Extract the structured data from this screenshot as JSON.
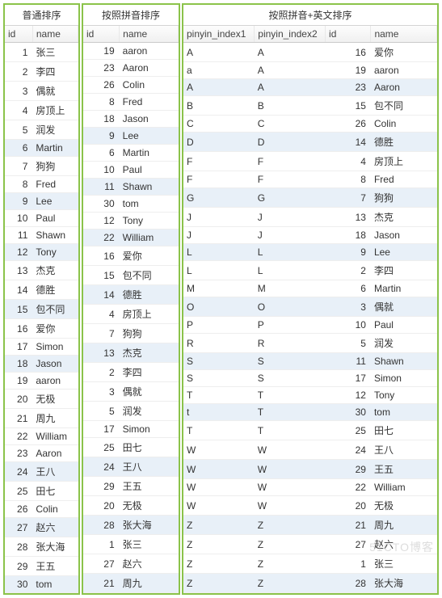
{
  "watermark": "51CTO博客",
  "panels": [
    {
      "title": "普通排序",
      "columns": [
        {
          "key": "id",
          "label": "id",
          "align": "num",
          "width": "38%"
        },
        {
          "key": "name",
          "label": "name",
          "align": "",
          "width": "62%"
        }
      ],
      "highlight": [
        5,
        8,
        11,
        14,
        17,
        23,
        26,
        29
      ],
      "rows": [
        {
          "id": 1,
          "name": "张三"
        },
        {
          "id": 2,
          "name": "李四"
        },
        {
          "id": 3,
          "name": "偶就"
        },
        {
          "id": 4,
          "name": "房顶上"
        },
        {
          "id": 5,
          "name": "润发"
        },
        {
          "id": 6,
          "name": "Martin"
        },
        {
          "id": 7,
          "name": "狗狗"
        },
        {
          "id": 8,
          "name": "Fred"
        },
        {
          "id": 9,
          "name": "Lee"
        },
        {
          "id": 10,
          "name": "Paul"
        },
        {
          "id": 11,
          "name": "Shawn"
        },
        {
          "id": 12,
          "name": "Tony"
        },
        {
          "id": 13,
          "name": "杰克"
        },
        {
          "id": 14,
          "name": "德胜"
        },
        {
          "id": 15,
          "name": "包不同"
        },
        {
          "id": 16,
          "name": "爱你"
        },
        {
          "id": 17,
          "name": "Simon"
        },
        {
          "id": 18,
          "name": "Jason"
        },
        {
          "id": 19,
          "name": "aaron"
        },
        {
          "id": 20,
          "name": "无极"
        },
        {
          "id": 21,
          "name": "周九"
        },
        {
          "id": 22,
          "name": "William"
        },
        {
          "id": 23,
          "name": "Aaron"
        },
        {
          "id": 24,
          "name": "王八"
        },
        {
          "id": 25,
          "name": "田七"
        },
        {
          "id": 26,
          "name": "Colin"
        },
        {
          "id": 27,
          "name": "赵六"
        },
        {
          "id": 28,
          "name": "张大海"
        },
        {
          "id": 29,
          "name": "王五"
        },
        {
          "id": 30,
          "name": "tom"
        }
      ]
    },
    {
      "title": "按照拼音排序",
      "columns": [
        {
          "key": "id",
          "label": "id",
          "align": "num",
          "width": "38%"
        },
        {
          "key": "name",
          "label": "name",
          "align": "",
          "width": "62%"
        }
      ],
      "highlight": [
        5,
        8,
        11,
        14,
        17,
        23,
        26,
        29
      ],
      "rows": [
        {
          "id": 19,
          "name": "aaron"
        },
        {
          "id": 23,
          "name": "Aaron"
        },
        {
          "id": 26,
          "name": "Colin"
        },
        {
          "id": 8,
          "name": "Fred"
        },
        {
          "id": 18,
          "name": "Jason"
        },
        {
          "id": 9,
          "name": "Lee"
        },
        {
          "id": 6,
          "name": "Martin"
        },
        {
          "id": 10,
          "name": "Paul"
        },
        {
          "id": 11,
          "name": "Shawn"
        },
        {
          "id": 30,
          "name": "tom"
        },
        {
          "id": 12,
          "name": "Tony"
        },
        {
          "id": 22,
          "name": "William"
        },
        {
          "id": 16,
          "name": "爱你"
        },
        {
          "id": 15,
          "name": "包不同"
        },
        {
          "id": 14,
          "name": "德胜"
        },
        {
          "id": 4,
          "name": "房顶上"
        },
        {
          "id": 7,
          "name": "狗狗"
        },
        {
          "id": 13,
          "name": "杰克"
        },
        {
          "id": 2,
          "name": "李四"
        },
        {
          "id": 3,
          "name": "偶就"
        },
        {
          "id": 5,
          "name": "润发"
        },
        {
          "id": 17,
          "name": "Simon"
        },
        {
          "id": 25,
          "name": "田七"
        },
        {
          "id": 24,
          "name": "王八"
        },
        {
          "id": 29,
          "name": "王五"
        },
        {
          "id": 20,
          "name": "无极"
        },
        {
          "id": 28,
          "name": "张大海"
        },
        {
          "id": 1,
          "name": "张三"
        },
        {
          "id": 27,
          "name": "赵六"
        },
        {
          "id": 21,
          "name": "周九"
        }
      ]
    },
    {
      "title": "按照拼音+英文排序",
      "columns": [
        {
          "key": "p1",
          "label": "pinyin_index1",
          "align": "",
          "width": "28%"
        },
        {
          "key": "p2",
          "label": "pinyin_index2",
          "align": "",
          "width": "28%"
        },
        {
          "key": "id",
          "label": "id",
          "align": "num",
          "width": "18%"
        },
        {
          "key": "name",
          "label": "name",
          "align": "",
          "width": "26%"
        }
      ],
      "highlight": [
        2,
        5,
        8,
        11,
        14,
        17,
        20,
        23,
        26,
        29
      ],
      "rows": [
        {
          "p1": "A",
          "p2": "A",
          "id": 16,
          "name": "爱你"
        },
        {
          "p1": "a",
          "p2": "A",
          "id": 19,
          "name": "aaron"
        },
        {
          "p1": "A",
          "p2": "A",
          "id": 23,
          "name": "Aaron"
        },
        {
          "p1": "B",
          "p2": "B",
          "id": 15,
          "name": "包不同"
        },
        {
          "p1": "C",
          "p2": "C",
          "id": 26,
          "name": "Colin"
        },
        {
          "p1": "D",
          "p2": "D",
          "id": 14,
          "name": "德胜"
        },
        {
          "p1": "F",
          "p2": "F",
          "id": 4,
          "name": "房顶上"
        },
        {
          "p1": "F",
          "p2": "F",
          "id": 8,
          "name": "Fred"
        },
        {
          "p1": "G",
          "p2": "G",
          "id": 7,
          "name": "狗狗"
        },
        {
          "p1": "J",
          "p2": "J",
          "id": 13,
          "name": "杰克"
        },
        {
          "p1": "J",
          "p2": "J",
          "id": 18,
          "name": "Jason"
        },
        {
          "p1": "L",
          "p2": "L",
          "id": 9,
          "name": "Lee"
        },
        {
          "p1": "L",
          "p2": "L",
          "id": 2,
          "name": "李四"
        },
        {
          "p1": "M",
          "p2": "M",
          "id": 6,
          "name": "Martin"
        },
        {
          "p1": "O",
          "p2": "O",
          "id": 3,
          "name": "偶就"
        },
        {
          "p1": "P",
          "p2": "P",
          "id": 10,
          "name": "Paul"
        },
        {
          "p1": "R",
          "p2": "R",
          "id": 5,
          "name": "润发"
        },
        {
          "p1": "S",
          "p2": "S",
          "id": 11,
          "name": "Shawn"
        },
        {
          "p1": "S",
          "p2": "S",
          "id": 17,
          "name": "Simon"
        },
        {
          "p1": "T",
          "p2": "T",
          "id": 12,
          "name": "Tony"
        },
        {
          "p1": "t",
          "p2": "T",
          "id": 30,
          "name": "tom"
        },
        {
          "p1": "T",
          "p2": "T",
          "id": 25,
          "name": "田七"
        },
        {
          "p1": "W",
          "p2": "W",
          "id": 24,
          "name": "王八"
        },
        {
          "p1": "W",
          "p2": "W",
          "id": 29,
          "name": "王五"
        },
        {
          "p1": "W",
          "p2": "W",
          "id": 22,
          "name": "William"
        },
        {
          "p1": "W",
          "p2": "W",
          "id": 20,
          "name": "无极"
        },
        {
          "p1": "Z",
          "p2": "Z",
          "id": 21,
          "name": "周九"
        },
        {
          "p1": "Z",
          "p2": "Z",
          "id": 27,
          "name": "赵六"
        },
        {
          "p1": "Z",
          "p2": "Z",
          "id": 1,
          "name": "张三"
        },
        {
          "p1": "Z",
          "p2": "Z",
          "id": 28,
          "name": "张大海"
        }
      ]
    }
  ]
}
